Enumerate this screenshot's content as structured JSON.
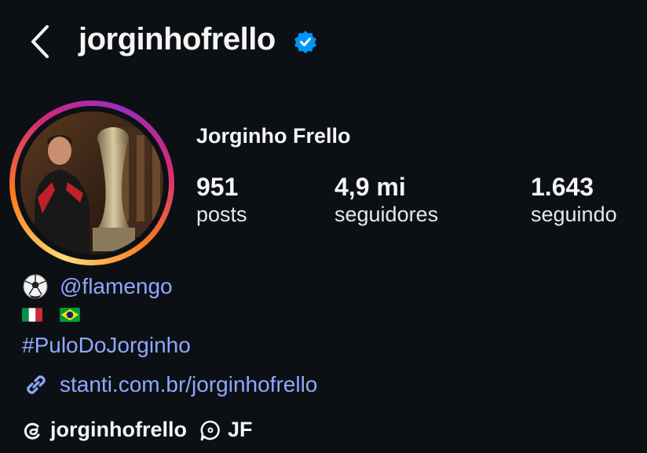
{
  "header": {
    "username": "jorginhofrello",
    "verified": true
  },
  "profile": {
    "full_name": "Jorginho Frello",
    "stats": [
      {
        "value": "951",
        "label": "posts"
      },
      {
        "value": "4,9 mi",
        "label": "seguidores"
      },
      {
        "value": "1.643",
        "label": "seguindo"
      }
    ]
  },
  "bio": {
    "club_mention": "@flamengo",
    "flags": [
      "flag-italy-icon",
      "flag-brazil-icon"
    ],
    "hashtag": "#PuloDoJorginho",
    "link": "stanti.com.br/jorginhofrello"
  },
  "threads": {
    "handle": "jorginhofrello",
    "note": "JF"
  },
  "colors": {
    "background": "#0c1014",
    "text": "#f5f5f5",
    "link": "#8fa8ff",
    "verified": "#0095f6"
  }
}
